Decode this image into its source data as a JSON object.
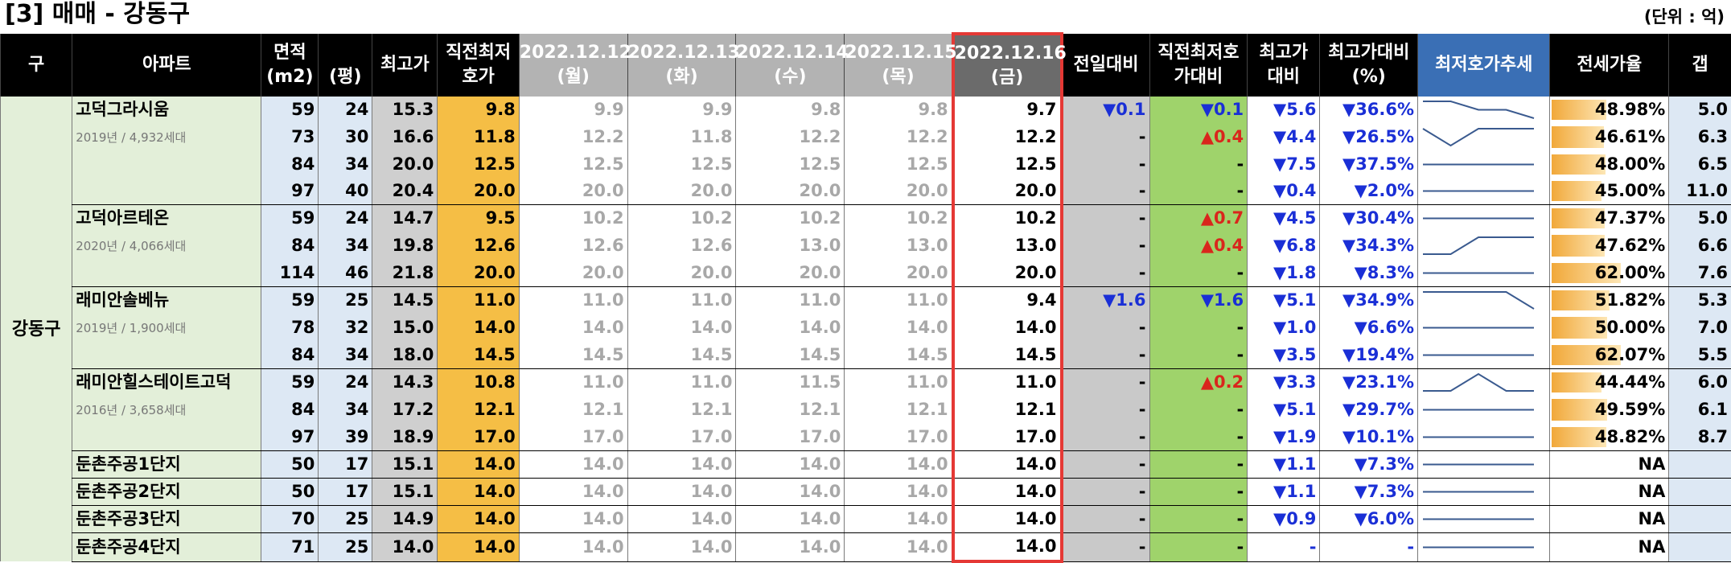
{
  "title": "[3] 매매 - 강동구",
  "unit": "(단위 : 억)",
  "columns": {
    "gu": "구",
    "apt": "아파트",
    "area_l1": "면적",
    "area_l2": "(m2)",
    "pyeong": "(평)",
    "high": "최고가",
    "prev_low_l1": "직전최저",
    "prev_low_l2": "호가",
    "d1_l1": "2022.12.12",
    "d1_l2": "(월)",
    "d2_l1": "2022.12.13",
    "d2_l2": "(화)",
    "d3_l1": "2022.12.14",
    "d3_l2": "(수)",
    "d4_l1": "2022.12.15",
    "d4_l2": "(목)",
    "d5_l1": "2022.12.16",
    "d5_l2": "(금)",
    "prev_day": "전일대비",
    "vs_prev_low_l1": "직전최저호",
    "vs_prev_low_l2": "가대비",
    "vs_high_l1": "최고가",
    "vs_high_l2": "대비",
    "vs_high_pct_l1": "최고가대비",
    "vs_high_pct_l2": "(%)",
    "trend": "최저호가추세",
    "jeonse": "전세가율",
    "gap": "갭"
  },
  "gu_name": "강동구",
  "groups": [
    {
      "name": "고덕그라시움",
      "sub": "2019년 / 4,932세대",
      "rows": [
        {
          "area": "59",
          "py": "24",
          "high": "15.3",
          "prev": "9.8",
          "d": [
            "9.9",
            "9.9",
            "9.8",
            "9.8"
          ],
          "cur": "9.7",
          "pd": "▼0.1",
          "pdc": "down",
          "vp": "▼0.1",
          "vpc": "down",
          "vh": "▼5.6",
          "vhp": "▼36.6%",
          "trend": [
            0.3,
            0.3,
            0.2,
            0.2,
            0.1
          ],
          "js": "48.98%",
          "jsv": 48.98,
          "gap": "5.0"
        },
        {
          "area": "73",
          "py": "30",
          "high": "16.6",
          "prev": "11.8",
          "d": [
            "12.2",
            "11.8",
            "12.2",
            "12.2"
          ],
          "cur": "12.2",
          "pd": "-",
          "pdc": "",
          "vp": "▲0.4",
          "vpc": "up",
          "vh": "▼4.4",
          "vhp": "▼26.5%",
          "trend": [
            0.4,
            0.0,
            0.4,
            0.4,
            0.4
          ],
          "js": "46.61%",
          "jsv": 46.61,
          "gap": "6.3"
        },
        {
          "area": "84",
          "py": "34",
          "high": "20.0",
          "prev": "12.5",
          "d": [
            "12.5",
            "12.5",
            "12.5",
            "12.5"
          ],
          "cur": "12.5",
          "pd": "-",
          "pdc": "",
          "vp": "-",
          "vpc": "",
          "vh": "▼7.5",
          "vhp": "▼37.5%",
          "trend": [
            0,
            0,
            0,
            0,
            0
          ],
          "js": "48.00%",
          "jsv": 48.0,
          "gap": "6.5"
        },
        {
          "area": "97",
          "py": "40",
          "high": "20.4",
          "prev": "20.0",
          "d": [
            "20.0",
            "20.0",
            "20.0",
            "20.0"
          ],
          "cur": "20.0",
          "pd": "-",
          "pdc": "",
          "vp": "-",
          "vpc": "",
          "vh": "▼0.4",
          "vhp": "▼2.0%",
          "trend": [
            0,
            0,
            0,
            0,
            0
          ],
          "js": "45.00%",
          "jsv": 45.0,
          "gap": "11.0"
        }
      ]
    },
    {
      "name": "고덕아르테온",
      "sub": "2020년 / 4,066세대",
      "rows": [
        {
          "area": "59",
          "py": "24",
          "high": "14.7",
          "prev": "9.5",
          "d": [
            "10.2",
            "10.2",
            "10.2",
            "10.2"
          ],
          "cur": "10.2",
          "pd": "-",
          "pdc": "",
          "vp": "▲0.7",
          "vpc": "up",
          "vh": "▼4.5",
          "vhp": "▼30.4%",
          "trend": [
            0,
            0,
            0,
            0,
            0
          ],
          "js": "47.37%",
          "jsv": 47.37,
          "gap": "5.0"
        },
        {
          "area": "84",
          "py": "34",
          "high": "19.8",
          "prev": "12.6",
          "d": [
            "12.6",
            "12.6",
            "13.0",
            "13.0"
          ],
          "cur": "13.0",
          "pd": "-",
          "pdc": "",
          "vp": "▲0.4",
          "vpc": "up",
          "vh": "▼6.8",
          "vhp": "▼34.3%",
          "trend": [
            12.6,
            12.6,
            13.0,
            13.0,
            13.0
          ],
          "js": "47.62%",
          "jsv": 47.62,
          "gap": "6.6"
        },
        {
          "area": "114",
          "py": "46",
          "high": "21.8",
          "prev": "20.0",
          "d": [
            "20.0",
            "20.0",
            "20.0",
            "20.0"
          ],
          "cur": "20.0",
          "pd": "-",
          "pdc": "",
          "vp": "-",
          "vpc": "",
          "vh": "▼1.8",
          "vhp": "▼8.3%",
          "trend": [
            0,
            0,
            0,
            0,
            0
          ],
          "js": "62.00%",
          "jsv": 62.0,
          "gap": "7.6"
        }
      ]
    },
    {
      "name": "래미안솔베뉴",
      "sub": "2019년 / 1,900세대",
      "rows": [
        {
          "area": "59",
          "py": "25",
          "high": "14.5",
          "prev": "11.0",
          "d": [
            "11.0",
            "11.0",
            "11.0",
            "11.0"
          ],
          "cur": "9.4",
          "pd": "▼1.6",
          "pdc": "down",
          "vp": "▼1.6",
          "vpc": "down",
          "vh": "▼5.1",
          "vhp": "▼34.9%",
          "trend": [
            11.0,
            11.0,
            11.0,
            11.0,
            9.4
          ],
          "js": "51.82%",
          "jsv": 51.82,
          "gap": "5.3"
        },
        {
          "area": "78",
          "py": "32",
          "high": "15.0",
          "prev": "14.0",
          "d": [
            "14.0",
            "14.0",
            "14.0",
            "14.0"
          ],
          "cur": "14.0",
          "pd": "-",
          "pdc": "",
          "vp": "-",
          "vpc": "",
          "vh": "▼1.0",
          "vhp": "▼6.6%",
          "trend": [
            0,
            0,
            0,
            0,
            0
          ],
          "js": "50.00%",
          "jsv": 50.0,
          "gap": "7.0"
        },
        {
          "area": "84",
          "py": "34",
          "high": "18.0",
          "prev": "14.5",
          "d": [
            "14.5",
            "14.5",
            "14.5",
            "14.5"
          ],
          "cur": "14.5",
          "pd": "-",
          "pdc": "",
          "vp": "-",
          "vpc": "",
          "vh": "▼3.5",
          "vhp": "▼19.4%",
          "trend": [
            0,
            0,
            0,
            0,
            0
          ],
          "js": "62.07%",
          "jsv": 62.07,
          "gap": "5.5"
        }
      ]
    },
    {
      "name": "래미안힐스테이트고덕",
      "sub": "2016년 / 3,658세대",
      "rows": [
        {
          "area": "59",
          "py": "24",
          "high": "14.3",
          "prev": "10.8",
          "d": [
            "11.0",
            "11.0",
            "11.5",
            "11.0"
          ],
          "cur": "11.0",
          "pd": "-",
          "pdc": "",
          "vp": "▲0.2",
          "vpc": "up",
          "vh": "▼3.3",
          "vhp": "▼23.1%",
          "trend": [
            11.0,
            11.0,
            11.5,
            11.0,
            11.0
          ],
          "js": "44.44%",
          "jsv": 44.44,
          "gap": "6.0"
        },
        {
          "area": "84",
          "py": "34",
          "high": "17.2",
          "prev": "12.1",
          "d": [
            "12.1",
            "12.1",
            "12.1",
            "12.1"
          ],
          "cur": "12.1",
          "pd": "-",
          "pdc": "",
          "vp": "-",
          "vpc": "",
          "vh": "▼5.1",
          "vhp": "▼29.7%",
          "trend": [
            0,
            0,
            0,
            0,
            0
          ],
          "js": "49.59%",
          "jsv": 49.59,
          "gap": "6.1"
        },
        {
          "area": "97",
          "py": "39",
          "high": "18.9",
          "prev": "17.0",
          "d": [
            "17.0",
            "17.0",
            "17.0",
            "17.0"
          ],
          "cur": "17.0",
          "pd": "-",
          "pdc": "",
          "vp": "-",
          "vpc": "",
          "vh": "▼1.9",
          "vhp": "▼10.1%",
          "trend": [
            0,
            0,
            0,
            0,
            0
          ],
          "js": "48.82%",
          "jsv": 48.82,
          "gap": "8.7"
        }
      ]
    },
    {
      "name": "둔촌주공1단지",
      "sub": "",
      "rows": [
        {
          "area": "50",
          "py": "17",
          "high": "15.1",
          "prev": "14.0",
          "d": [
            "14.0",
            "14.0",
            "14.0",
            "14.0"
          ],
          "cur": "14.0",
          "pd": "-",
          "pdc": "",
          "vp": "-",
          "vpc": "",
          "vh": "▼1.1",
          "vhp": "▼7.3%",
          "trend": [
            0,
            0,
            0,
            0,
            0
          ],
          "js": "NA",
          "jsv": 0,
          "gap": ""
        }
      ]
    },
    {
      "name": "둔촌주공2단지",
      "sub": "",
      "rows": [
        {
          "area": "50",
          "py": "17",
          "high": "15.1",
          "prev": "14.0",
          "d": [
            "14.0",
            "14.0",
            "14.0",
            "14.0"
          ],
          "cur": "14.0",
          "pd": "-",
          "pdc": "",
          "vp": "-",
          "vpc": "",
          "vh": "▼1.1",
          "vhp": "▼7.3%",
          "trend": [
            0,
            0,
            0,
            0,
            0
          ],
          "js": "NA",
          "jsv": 0,
          "gap": ""
        }
      ]
    },
    {
      "name": "둔촌주공3단지",
      "sub": "",
      "rows": [
        {
          "area": "70",
          "py": "25",
          "high": "14.9",
          "prev": "14.0",
          "d": [
            "14.0",
            "14.0",
            "14.0",
            "14.0"
          ],
          "cur": "14.0",
          "pd": "-",
          "pdc": "",
          "vp": "-",
          "vpc": "",
          "vh": "▼0.9",
          "vhp": "▼6.0%",
          "trend": [
            0,
            0,
            0,
            0,
            0
          ],
          "js": "NA",
          "jsv": 0,
          "gap": ""
        }
      ]
    },
    {
      "name": "둔촌주공4단지",
      "sub": "",
      "rows": [
        {
          "area": "71",
          "py": "25",
          "high": "14.0",
          "prev": "14.0",
          "d": [
            "14.0",
            "14.0",
            "14.0",
            "14.0"
          ],
          "cur": "14.0",
          "pd": "-",
          "pdc": "",
          "vp": "-",
          "vpc": "",
          "vh": "-",
          "vhp": "-",
          "trend": [
            0,
            0,
            0,
            0,
            0
          ],
          "js": "NA",
          "jsv": 0,
          "gap": ""
        }
      ]
    }
  ],
  "colors": {
    "header_bg": "#000000",
    "date_past_bg": "#b3b3b3",
    "selected_border": "#e53935",
    "trend_header": "#3a6fb5",
    "down": "#1a2fd6",
    "up": "#d9261c",
    "prev_low_bg": "#f5be45",
    "vs_prev_bg": "#9fd36b"
  }
}
